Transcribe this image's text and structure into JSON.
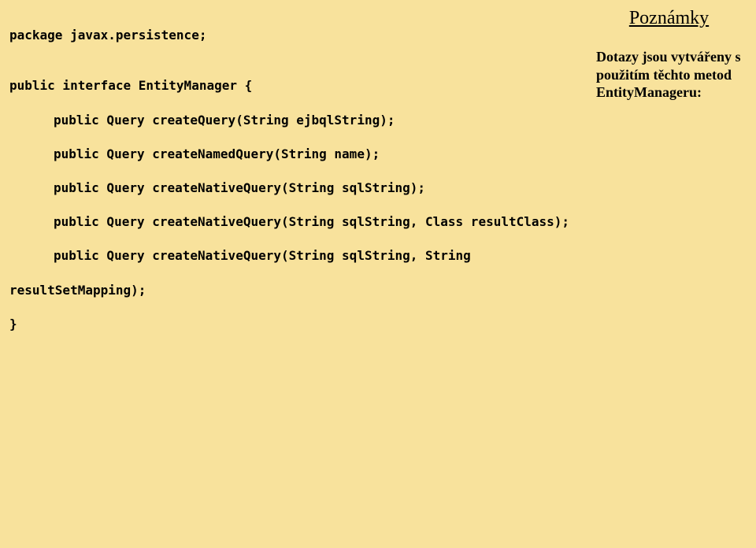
{
  "code": {
    "line1": "package javax.persistence;",
    "blank1": "",
    "line2": "public interface EntityManager {",
    "line3": "public Query createQuery(String ejbqlString);",
    "line4": "public Query createNamedQuery(String name);",
    "line5": "public Query createNativeQuery(String sqlString);",
    "line6": "public Query createNativeQuery(String sqlString, Class resultClass);",
    "line7": "public Query createNativeQuery(String sqlString, String",
    "line8": "resultSetMapping);",
    "line9": "}"
  },
  "notes": {
    "title": "Poznámky",
    "body": "Dotazy jsou vytvářeny s použitím těchto metod EntityManageru:"
  }
}
